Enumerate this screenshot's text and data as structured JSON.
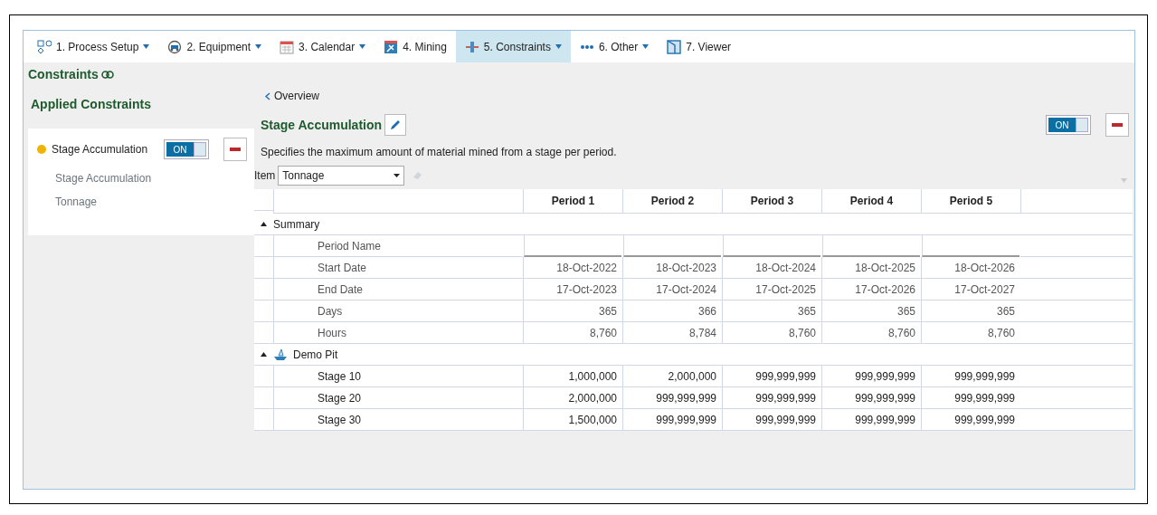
{
  "toolbar": {
    "tabs": [
      {
        "label": "1. Process Setup",
        "dropdown": true,
        "selected": false
      },
      {
        "label": "2. Equipment",
        "dropdown": true,
        "selected": false
      },
      {
        "label": "3. Calendar",
        "dropdown": true,
        "selected": false
      },
      {
        "label": "4. Mining",
        "dropdown": false,
        "selected": false
      },
      {
        "label": "5. Constraints",
        "dropdown": true,
        "selected": true
      },
      {
        "label": "6. Other",
        "dropdown": true,
        "selected": false
      },
      {
        "label": "7. Viewer",
        "dropdown": false,
        "selected": false
      }
    ]
  },
  "page_title": "Constraints",
  "sidebar": {
    "heading": "Applied Constraints",
    "items": [
      {
        "name": "Stage Accumulation",
        "color": "#f0b400",
        "on": true,
        "toggle_label": "ON",
        "details": [
          "Stage Accumulation",
          "Tonnage"
        ]
      }
    ]
  },
  "detail": {
    "back_link": "Overview",
    "title": "Stage Accumulation",
    "on": true,
    "toggle_label": "ON",
    "description": "Specifies the maximum amount of material mined from a stage per period.",
    "item_label": "Item",
    "item_value": "Tonnage",
    "table": {
      "columns": [
        "Period 1",
        "Period 2",
        "Period 3",
        "Period 4",
        "Period 5"
      ],
      "groups": [
        {
          "label": "Summary",
          "kind": "summary",
          "expanded": true,
          "rows": [
            {
              "name": "Period Name",
              "values": []
            },
            {
              "name": "Start Date",
              "values": [
                "18-Oct-2022",
                "18-Oct-2023",
                "18-Oct-2024",
                "18-Oct-2025",
                "18-Oct-2026"
              ]
            },
            {
              "name": "End Date",
              "values": [
                "17-Oct-2023",
                "17-Oct-2024",
                "17-Oct-2025",
                "17-Oct-2026",
                "17-Oct-2027"
              ]
            },
            {
              "name": "Days",
              "values": [
                "365",
                "366",
                "365",
                "365",
                "365"
              ]
            },
            {
              "name": "Hours",
              "values": [
                "8,760",
                "8,784",
                "8,760",
                "8,760",
                "8,760"
              ]
            }
          ]
        },
        {
          "label": "Demo Pit",
          "kind": "pit",
          "expanded": true,
          "rows": [
            {
              "name": "Stage 10",
              "values": [
                "1,000,000",
                "2,000,000",
                "999,999,999",
                "999,999,999",
                "999,999,999"
              ]
            },
            {
              "name": "Stage 20",
              "values": [
                "2,000,000",
                "999,999,999",
                "999,999,999",
                "999,999,999",
                "999,999,999"
              ]
            },
            {
              "name": "Stage 30",
              "values": [
                "1,500,000",
                "999,999,999",
                "999,999,999",
                "999,999,999",
                "999,999,999"
              ]
            }
          ]
        }
      ]
    }
  }
}
